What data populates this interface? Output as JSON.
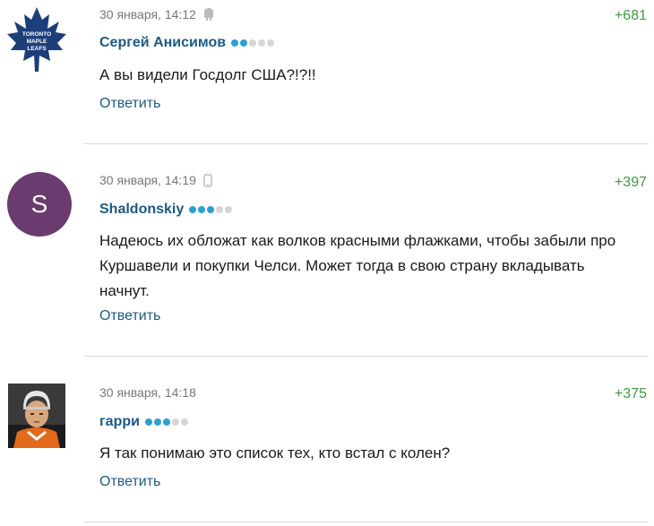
{
  "colors": {
    "score": "#3f9a3f",
    "rating_on": "#2e9fd6",
    "rating_off": "#d6d6d6",
    "s_avatar": "#6b3a6e"
  },
  "comments": [
    {
      "date": "30 января, 14:12",
      "device_icon": "android-icon",
      "score": "+681",
      "author": "Сергей Анисимов",
      "rating": 2,
      "text": "А вы видели Госдолг США?!?!!",
      "reply": "Ответить",
      "avatar": "maple-leafs-logo",
      "logo_text": "TORONTO MAPLE LEAFS"
    },
    {
      "date": "30 января, 14:19",
      "device_icon": "mobile-phone-icon",
      "score": "+397",
      "author": "Shaldonskiy",
      "rating": 3,
      "text": "Надеюсь их обложат как волков красными флажками, чтобы забыли про Куршавели и покупки Челси. Может тогда в свою страну вкладывать начнут.",
      "reply": "Ответить",
      "avatar_letter": "S"
    },
    {
      "date": "30 января, 14:18",
      "score": "+375",
      "author": "гарри",
      "rating": 3,
      "text": "Я так понимаю это список тех, кто встал с колен?",
      "reply": "Ответить",
      "avatar": "hockey-player-photo"
    }
  ]
}
